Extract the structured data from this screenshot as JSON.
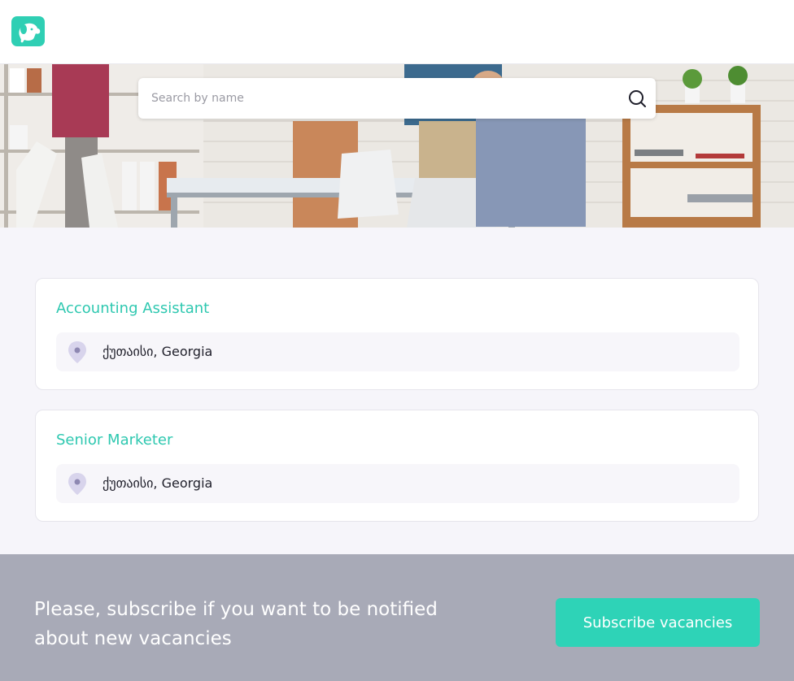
{
  "brand": {
    "logo_icon": "dog-icon",
    "accent_color": "#2fcfb4"
  },
  "search": {
    "placeholder": "Search by name",
    "icon": "search-icon"
  },
  "vacancies": [
    {
      "title": "Accounting Assistant",
      "location": "ქუთაისი, Georgia",
      "icon": "location-pin-icon"
    },
    {
      "title": "Senior Marketer",
      "location": "ქუთაისი, Georgia",
      "icon": "location-pin-icon"
    }
  ],
  "footer": {
    "message": "Please, subscribe if you want to be notified about new vacancies",
    "button_label": "Subscribe vacancies"
  }
}
